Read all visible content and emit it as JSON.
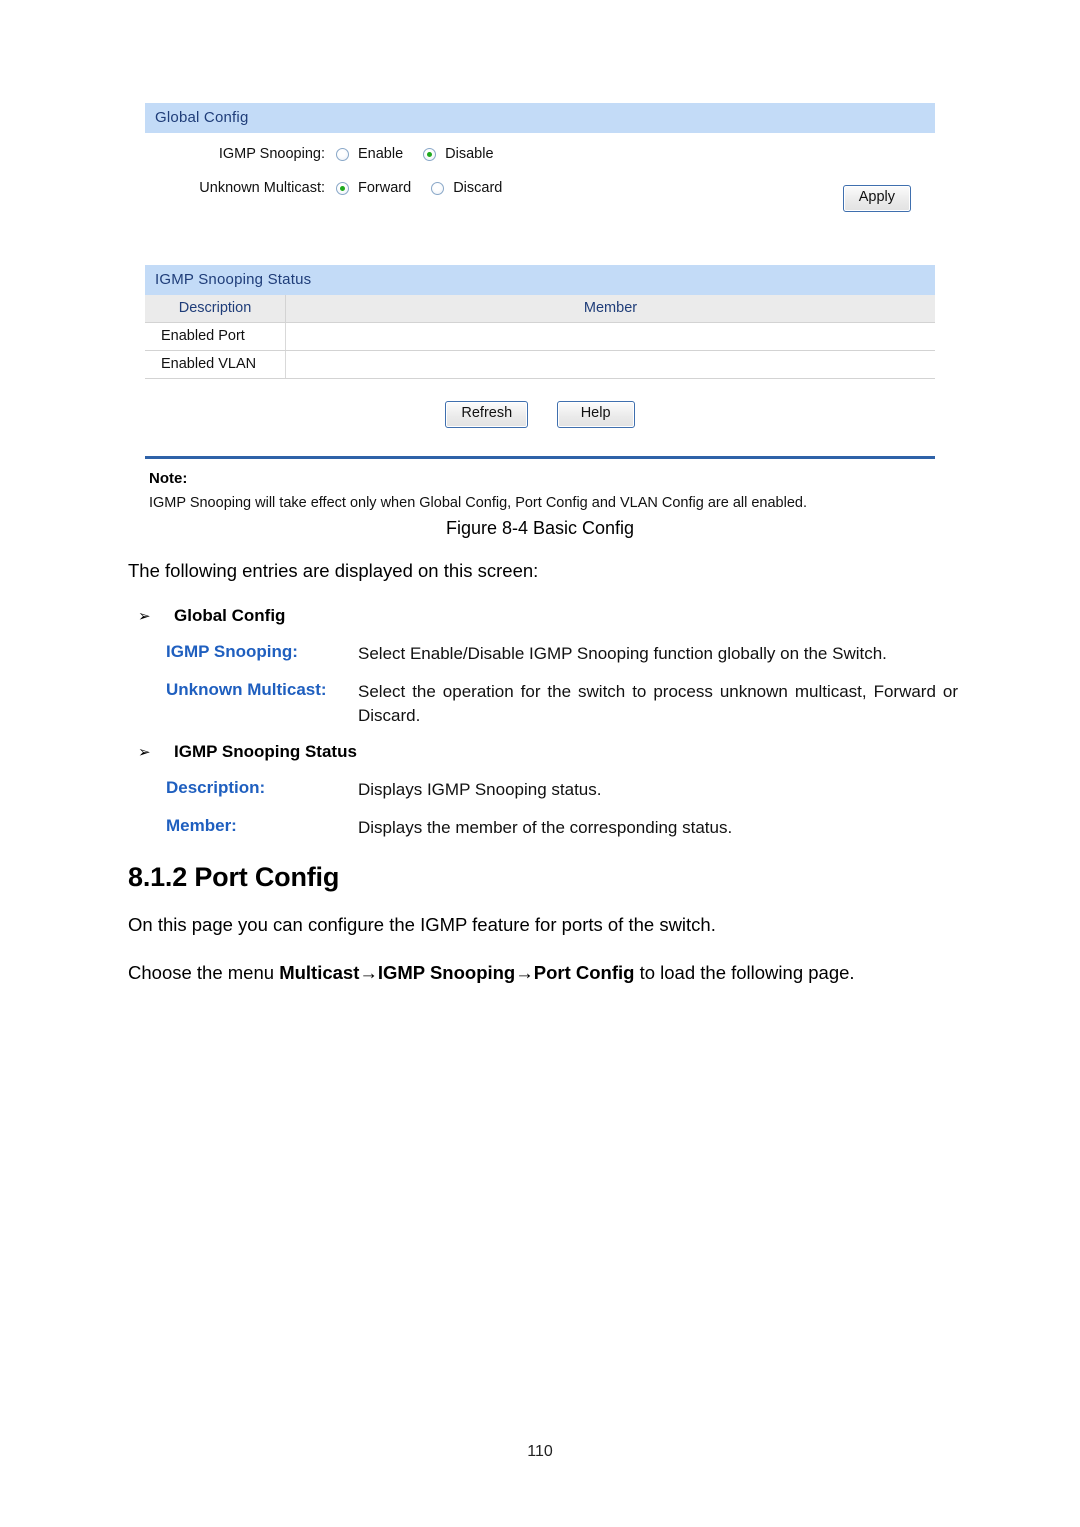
{
  "screenshot": {
    "global_config": {
      "panel_title": "Global Config",
      "rows": [
        {
          "label": "IGMP Snooping:",
          "options": [
            {
              "text": "Enable",
              "selected": false
            },
            {
              "text": "Disable",
              "selected": true
            }
          ]
        },
        {
          "label": "Unknown Multicast:",
          "options": [
            {
              "text": "Forward",
              "selected": true
            },
            {
              "text": "Discard",
              "selected": false
            }
          ]
        }
      ],
      "apply_label": "Apply"
    },
    "status": {
      "panel_title": "IGMP Snooping Status",
      "columns": [
        "Description",
        "Member"
      ],
      "rows": [
        {
          "description": "Enabled Port",
          "member": ""
        },
        {
          "description": "Enabled VLAN",
          "member": ""
        }
      ],
      "refresh_label": "Refresh",
      "help_label": "Help"
    },
    "note": {
      "title": "Note:",
      "text": "IGMP Snooping will take effect only when Global Config, Port Config and VLAN Config are all enabled."
    },
    "caption": "Figure 8-4 Basic Config"
  },
  "doc": {
    "intro": "The following entries are displayed on this screen:",
    "bullet_glyph": "➢",
    "sections": [
      {
        "heading": "Global Config",
        "items": [
          {
            "term": "IGMP Snooping:",
            "desc": "Select Enable/Disable IGMP Snooping function globally on the Switch."
          },
          {
            "term": "Unknown Multicast:",
            "desc": "Select the operation for the switch to process unknown multicast, Forward or Discard."
          }
        ]
      },
      {
        "heading": "IGMP Snooping Status",
        "items": [
          {
            "term": "Description:",
            "desc": "Displays IGMP Snooping status."
          },
          {
            "term": "Member:",
            "desc": "Displays the member of the corresponding status."
          }
        ]
      }
    ],
    "section_heading": "8.1.2 Port Config",
    "body_para": "On this page you can configure the IGMP feature for ports of the switch.",
    "choose_prefix": "Choose the menu ",
    "choose_path": "Multicast→IGMP Snooping→Port Config",
    "choose_suffix": " to load the following page.",
    "page_number": "110"
  }
}
